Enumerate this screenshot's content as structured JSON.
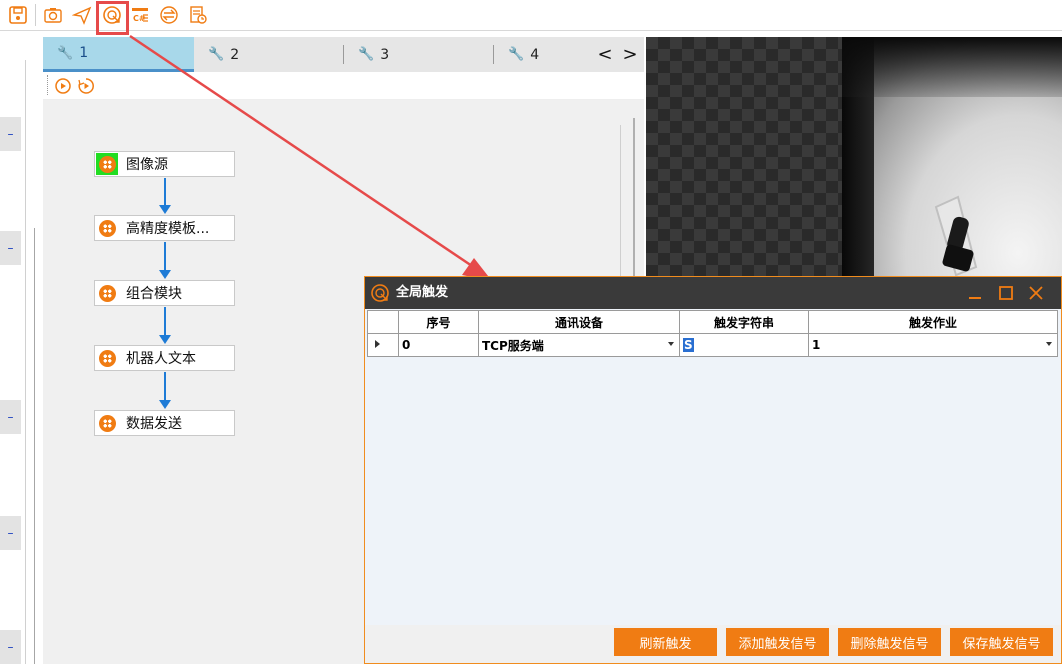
{
  "tabs": [
    {
      "label": "1",
      "active": true
    },
    {
      "label": "2",
      "active": false
    },
    {
      "label": "3",
      "active": false
    },
    {
      "label": "4",
      "active": false
    }
  ],
  "tab_nav": {
    "prev": "<",
    "next": ">"
  },
  "left_strip_buttons": [
    "–",
    "–",
    "–",
    "–",
    "–"
  ],
  "flow_nodes": [
    {
      "label": "图像源",
      "icon": "module-icon",
      "highlight": true
    },
    {
      "label": "高精度模板...",
      "icon": "module-icon",
      "highlight": false
    },
    {
      "label": "组合模块",
      "icon": "module-icon",
      "highlight": false
    },
    {
      "label": "机器人文本",
      "icon": "module-icon",
      "highlight": false
    },
    {
      "label": "数据发送",
      "icon": "module-icon",
      "highlight": false
    }
  ],
  "dialog": {
    "title": "全局触发",
    "columns": [
      "序号",
      "通讯设备",
      "触发字符串",
      "触发作业"
    ],
    "rows": [
      {
        "index": "0",
        "device": "TCP服务端",
        "trigger_string": "S",
        "job": "1"
      }
    ],
    "buttons": [
      "刷新触发",
      "添加触发信号",
      "删除触发信号",
      "保存触发信号"
    ]
  },
  "colors": {
    "accent": "#f07c13",
    "highlight_box": "#e64a4a",
    "tab_active": "#a8d8ea",
    "connector": "#1e7bd6"
  }
}
